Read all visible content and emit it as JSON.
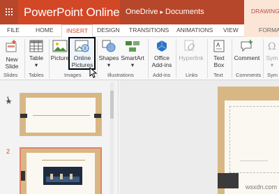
{
  "title_bar": {
    "app_name": "PowerPoint Online",
    "breadcrumb_root": "OneDrive",
    "breadcrumb_sep": "▸",
    "breadcrumb_folder": "Documents",
    "context_label": "DRAWING TO"
  },
  "tabs": [
    "FILE",
    "HOME",
    "INSERT",
    "DESIGN",
    "TRANSITIONS",
    "ANIMATIONS",
    "VIEW"
  ],
  "active_tab": "INSERT",
  "format_tab": "FORMAT",
  "ribbon": {
    "new_slide": [
      "New",
      "Slide"
    ],
    "table": [
      "Table",
      "▾"
    ],
    "picture": "Picture",
    "online_pictures": [
      "Online",
      "Pictures"
    ],
    "shapes": [
      "Shapes",
      "▾"
    ],
    "smartart": [
      "SmartArt",
      "▾"
    ],
    "office_addins": [
      "Office",
      "Add-ins"
    ],
    "hyperlink": "Hyperlink",
    "textbox": [
      "Text",
      "Box"
    ],
    "comment": "Comment",
    "symbol": [
      "Sym",
      "▾"
    ],
    "groups": {
      "slides": "Slides",
      "tables": "Tables",
      "images": "Images",
      "illustrations": "Illustrations",
      "addins": "Add-ins",
      "links": "Links",
      "text": "Text",
      "comments": "Comments",
      "symbols": "Sym"
    }
  },
  "slides_pane": {
    "slide_numbers": [
      "1",
      "2"
    ]
  },
  "watermark": "wsxdn.com",
  "colors": {
    "accent": "#d24726",
    "crumb": "#b7472a",
    "wood": "#d9b784"
  }
}
